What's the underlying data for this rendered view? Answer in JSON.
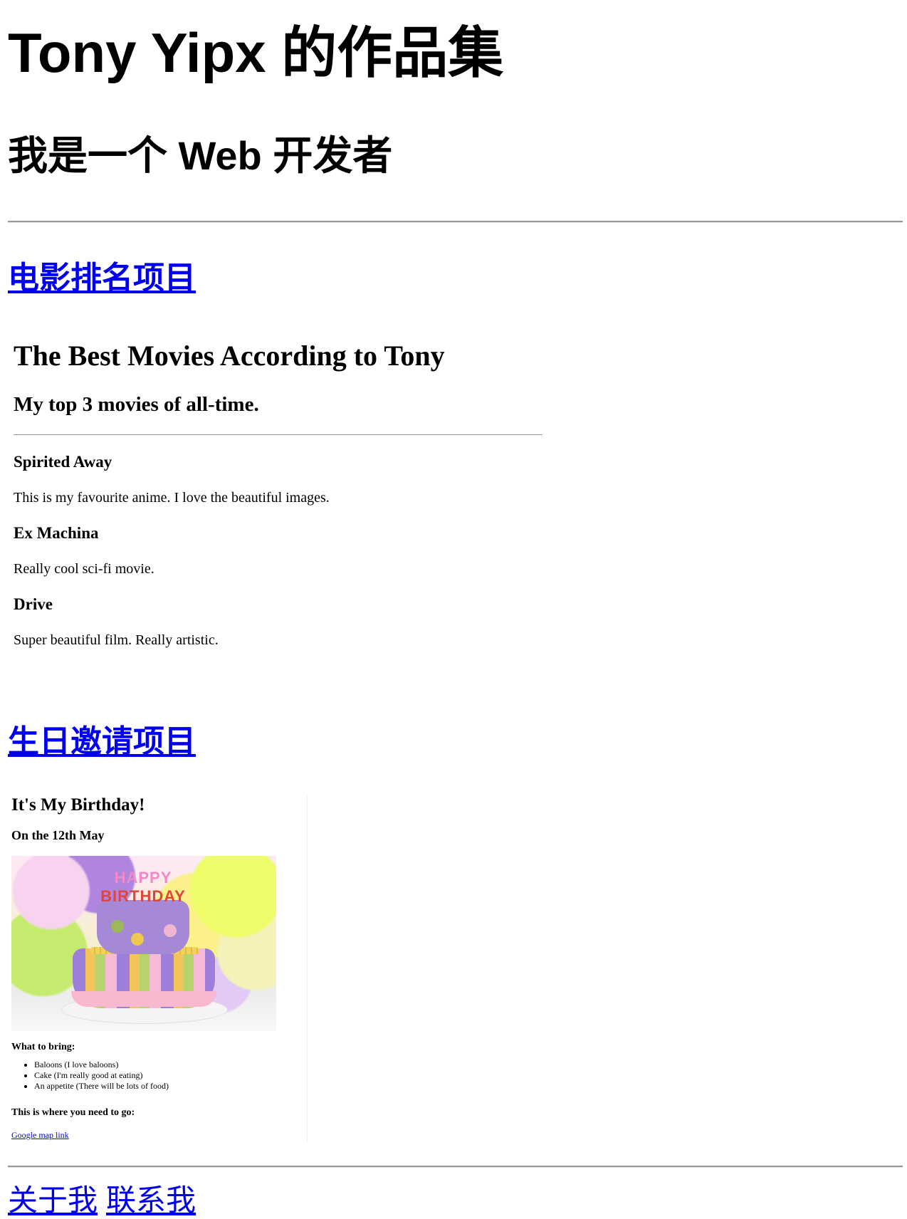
{
  "header": {
    "title": "Tony Yipx 的作品集",
    "subtitle": "我是一个 Web 开发者"
  },
  "projects": [
    {
      "link": "电影排名项目"
    },
    {
      "link": "生日邀请项目"
    }
  ],
  "movies": {
    "title": "The Best Movies According to Tony",
    "subtitle": "My top 3 movies of all-time.",
    "items": [
      {
        "name": "Spirited Away",
        "desc": "This is my favourite anime. I love the beautiful images."
      },
      {
        "name": "Ex Machina",
        "desc": "Really cool sci-fi movie."
      },
      {
        "name": "Drive",
        "desc": "Super beautiful film. Really artistic."
      }
    ]
  },
  "birthday": {
    "title": "It's My Birthday!",
    "date": "On the 12th May",
    "image_text": {
      "line1": "HAPPY",
      "line2": "BIRTHDAY"
    },
    "bring_heading": "What to bring:",
    "bring_items": [
      "Baloons (I love baloons)",
      "Cake (I'm really good at eating)",
      "An appetite (There will be lots of food)"
    ],
    "where_heading": "This is where you need to go:",
    "map_link": "Google map link"
  },
  "footer": {
    "about": "关于我",
    "contact": "联系我"
  }
}
